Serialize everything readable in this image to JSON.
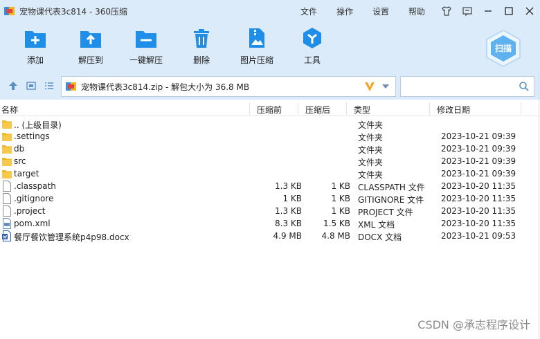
{
  "window": {
    "title": "宠物课代表3c814 - 360压缩",
    "menus": [
      "文件",
      "操作",
      "设置",
      "帮助"
    ]
  },
  "toolbar": {
    "add_label": "添加",
    "extract_to_label": "解压到",
    "one_click_extract_label": "一键解压",
    "delete_label": "删除",
    "image_compress_label": "图片压缩",
    "tools_label": "工具",
    "scan_label": "扫描"
  },
  "address": {
    "path": "宠物课代表3c814.zip - 解包大小为 36.8 MB",
    "search_placeholder": ""
  },
  "columns": {
    "name": "名称",
    "compressed_before": "压缩前",
    "compressed_after": "压缩后",
    "type": "类型",
    "modified": "修改日期"
  },
  "files": [
    {
      "name": ".. (上级目录)",
      "size": "",
      "csize": "",
      "type": "文件夹",
      "date": "",
      "icon": "folder-icon"
    },
    {
      "name": ".settings",
      "size": "",
      "csize": "",
      "type": "文件夹",
      "date": "2023-10-21 09:39",
      "icon": "folder-icon"
    },
    {
      "name": "db",
      "size": "",
      "csize": "",
      "type": "文件夹",
      "date": "2023-10-21 09:39",
      "icon": "folder-icon"
    },
    {
      "name": "src",
      "size": "",
      "csize": "",
      "type": "文件夹",
      "date": "2023-10-21 09:39",
      "icon": "folder-icon"
    },
    {
      "name": "target",
      "size": "",
      "csize": "",
      "type": "文件夹",
      "date": "2023-10-21 09:39",
      "icon": "folder-icon"
    },
    {
      "name": ".classpath",
      "size": "1.3 KB",
      "csize": "1 KB",
      "type": "CLASSPATH 文件",
      "date": "2023-10-20 11:35",
      "icon": "file-icon"
    },
    {
      "name": ".gitignore",
      "size": "1 KB",
      "csize": "1 KB",
      "type": "GITIGNORE 文件",
      "date": "2023-10-20 11:35",
      "icon": "file-icon"
    },
    {
      "name": ".project",
      "size": "1.3 KB",
      "csize": "1 KB",
      "type": "PROJECT 文件",
      "date": "2023-10-20 11:35",
      "icon": "file-icon"
    },
    {
      "name": "pom.xml",
      "size": "8.3 KB",
      "csize": "1.5 KB",
      "type": "XML 文档",
      "date": "2023-10-20 11:35",
      "icon": "xml-file-icon"
    },
    {
      "name": "餐厅餐饮管理系统p4p98.docx",
      "size": "4.9 MB",
      "csize": "4.8 MB",
      "type": "DOCX 文档",
      "date": "2023-10-21 09:53",
      "icon": "docx-file-icon"
    }
  ],
  "watermark": "CSDN @承志程序设计",
  "colors": {
    "chrome_bg": "#dcebf9",
    "accent_blue": "#1e8ee8",
    "folder_yellow": "#f2b61f"
  }
}
